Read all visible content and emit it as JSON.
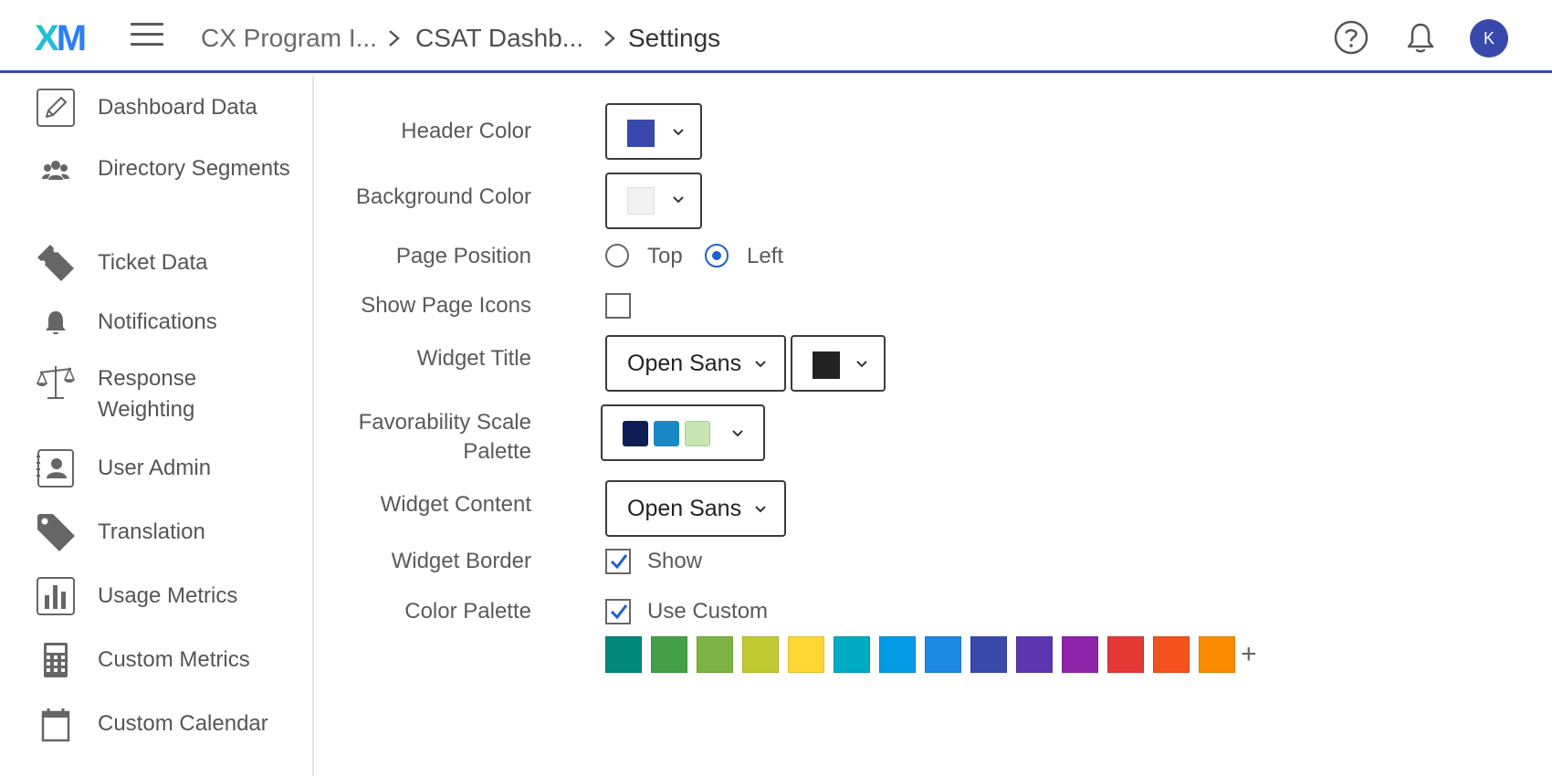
{
  "header": {
    "logo_x": "X",
    "logo_m": "M",
    "breadcrumbs": [
      "CX Program I...",
      "CSAT Dashb...",
      "Settings"
    ],
    "avatar_initial": "K"
  },
  "sidebar": {
    "items": [
      {
        "label": "Dashboard Data",
        "icon": "pencil-icon"
      },
      {
        "label": "Directory Segments",
        "icon": "users-icon"
      },
      {
        "label": "Ticket Data",
        "icon": "ticket-icon"
      },
      {
        "label": "Notifications",
        "icon": "bell-icon"
      },
      {
        "label": "Response Weighting",
        "icon": "scale-icon"
      },
      {
        "label": "User Admin",
        "icon": "user-card-icon"
      },
      {
        "label": "Translation",
        "icon": "tag-icon"
      },
      {
        "label": "Usage Metrics",
        "icon": "bar-chart-icon"
      },
      {
        "label": "Custom Metrics",
        "icon": "calculator-icon"
      },
      {
        "label": "Custom Calendar",
        "icon": "calendar-icon"
      }
    ]
  },
  "form": {
    "header_color": {
      "label": "Header Color",
      "value": "#3949ab"
    },
    "background_color": {
      "label": "Background Color",
      "value": "#f2f2f2"
    },
    "page_position": {
      "label": "Page Position",
      "options": [
        "Top",
        "Left"
      ],
      "selected": "Left"
    },
    "show_page_icons": {
      "label": "Show Page Icons",
      "checked": false
    },
    "widget_title": {
      "label": "Widget Title",
      "font": "Open Sans",
      "color": "#222222"
    },
    "favorability": {
      "label_line1": "Favorability Scale",
      "label_line2": "Palette",
      "colors": [
        "#0d1d56",
        "#1a88c4",
        "#c6e6b3"
      ]
    },
    "widget_content": {
      "label": "Widget Content",
      "font": "Open Sans"
    },
    "widget_border": {
      "label": "Widget Border",
      "option": "Show",
      "checked": true
    },
    "color_palette": {
      "label": "Color Palette",
      "option": "Use Custom",
      "checked": true,
      "colors": [
        "#00897b",
        "#43a047",
        "#7cb342",
        "#c0ca33",
        "#fdd835",
        "#00acc1",
        "#039be5",
        "#1e88e5",
        "#3949ab",
        "#5e35b1",
        "#8e24aa",
        "#e53935",
        "#f4511e",
        "#fb8c00"
      ],
      "add_label": "+"
    }
  }
}
